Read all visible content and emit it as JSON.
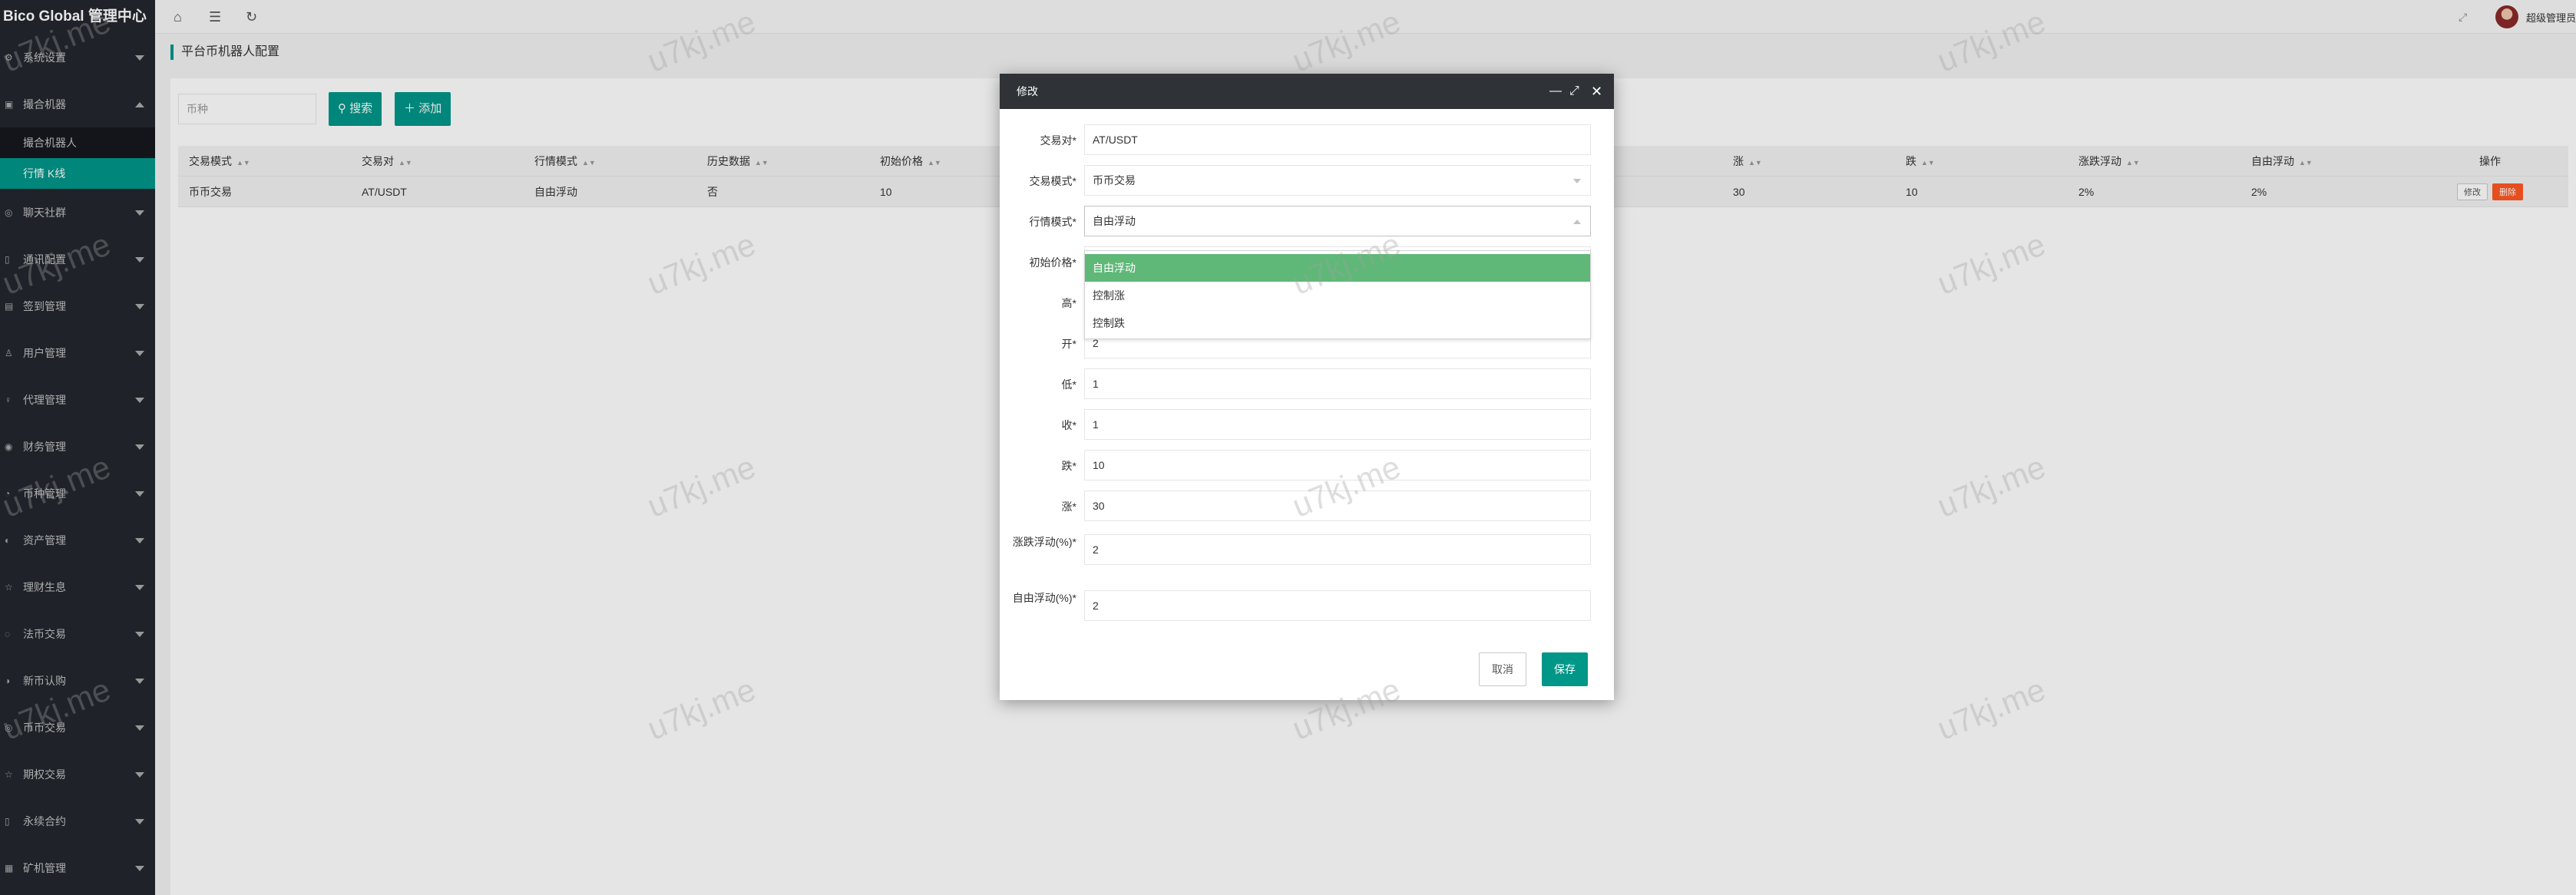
{
  "brand": {
    "title": "Bico Global 管理中心"
  },
  "sidebar": {
    "items": [
      {
        "label": "系统设置",
        "icon": "gear-icon",
        "glyph": "⚙",
        "expanded": false
      },
      {
        "label": "撮合机器",
        "icon": "robot-icon",
        "glyph": "▣",
        "expanded": true,
        "children": [
          {
            "label": "撮合机器人",
            "active": false
          },
          {
            "label": "行情 K线",
            "active": true
          }
        ]
      },
      {
        "label": "聊天社群",
        "icon": "chat-icon",
        "glyph": "◎",
        "expanded": false
      },
      {
        "label": "通讯配置",
        "icon": "phone-icon",
        "glyph": "▯",
        "expanded": false
      },
      {
        "label": "签到管理",
        "icon": "calendar-icon",
        "glyph": "▤",
        "expanded": false
      },
      {
        "label": "用户管理",
        "icon": "user-icon",
        "glyph": "♙",
        "expanded": false
      },
      {
        "label": "代理管理",
        "icon": "agent-icon",
        "glyph": "♀",
        "expanded": false
      },
      {
        "label": "财务管理",
        "icon": "finance-icon",
        "glyph": "◉",
        "expanded": false
      },
      {
        "label": "币种管理",
        "icon": "coin-icon",
        "glyph": "◔",
        "expanded": false
      },
      {
        "label": "资产管理",
        "icon": "asset-icon",
        "glyph": "◐",
        "expanded": false
      },
      {
        "label": "理财生息",
        "icon": "star-icon",
        "glyph": "☆",
        "expanded": false
      },
      {
        "label": "法币交易",
        "icon": "cash-icon",
        "glyph": "◌",
        "expanded": false
      },
      {
        "label": "新币认购",
        "icon": "new-coin-icon",
        "glyph": "◑",
        "expanded": false
      },
      {
        "label": "币币交易",
        "icon": "exchange-icon",
        "glyph": "◎",
        "expanded": false
      },
      {
        "label": "期权交易",
        "icon": "option-icon",
        "glyph": "☆",
        "expanded": false
      },
      {
        "label": "永续合约",
        "icon": "contract-icon",
        "glyph": "▯",
        "expanded": false
      },
      {
        "label": "矿机管理",
        "icon": "miner-icon",
        "glyph": "▦",
        "expanded": false
      }
    ]
  },
  "header": {
    "icons": [
      {
        "name": "home-icon",
        "glyph": "⌂"
      },
      {
        "name": "menu-toggle-icon",
        "glyph": "☰"
      },
      {
        "name": "refresh-icon",
        "glyph": "↻"
      }
    ],
    "fullscreen_glyph": "⤢",
    "user_name": "超级管理员"
  },
  "page": {
    "title": "平台币机器人配置",
    "search_placeholder": "币种",
    "search_button": "搜索",
    "add_button": "添加",
    "table": {
      "columns": [
        "交易模式",
        "交易对",
        "行情模式",
        "历史数据",
        "初始价格",
        "涨",
        "跌",
        "涨跌浮动",
        "自由浮动",
        "操作"
      ],
      "rows": [
        {
          "cells": [
            "币币交易",
            "AT/USDT",
            "自由浮动",
            "否",
            "10",
            "30",
            "10",
            "2%",
            "2%"
          ],
          "edit": "修改",
          "delete": "删除"
        }
      ]
    }
  },
  "modal": {
    "title": "修改",
    "fields": [
      {
        "label": "交易对*",
        "value": "AT/USDT",
        "type": "input"
      },
      {
        "label": "交易模式*",
        "value": "币币交易",
        "type": "select"
      },
      {
        "label": "行情模式*",
        "value": "自由浮动",
        "type": "select",
        "open": true
      },
      {
        "label": "初始价格*",
        "value": "",
        "type": "input"
      },
      {
        "label": "高*",
        "value": "",
        "type": "input"
      },
      {
        "label": "开*",
        "value": "2",
        "type": "input"
      },
      {
        "label": "低*",
        "value": "1",
        "type": "input"
      },
      {
        "label": "收*",
        "value": "1",
        "type": "input"
      },
      {
        "label": "跌*",
        "value": "10",
        "type": "input"
      },
      {
        "label": "涨*",
        "value": "30",
        "type": "input"
      },
      {
        "label": "涨跌浮动(%)*",
        "value": "2",
        "type": "input"
      },
      {
        "label": "自由浮动(%)*",
        "value": "2",
        "type": "input"
      }
    ],
    "dropdown_options": [
      "自由浮动",
      "控制涨",
      "控制跌"
    ],
    "dropdown_selected": 0,
    "cancel": "取消",
    "save": "保存"
  },
  "watermark": "u7kj.me"
}
